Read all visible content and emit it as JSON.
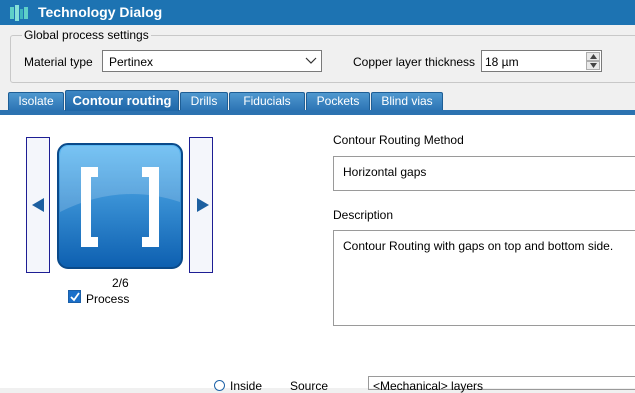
{
  "window": {
    "title": "Technology Dialog",
    "icon": "app-logo-icon"
  },
  "global_settings": {
    "group_label": "Global process settings",
    "material_type_label": "Material type",
    "material_type_value": "Pertinex",
    "copper_thickness_label": "Copper layer thickness",
    "copper_thickness_value": "18 µm"
  },
  "tabs": [
    {
      "label": "Isolate",
      "active": false
    },
    {
      "label": "Contour routing",
      "active": true
    },
    {
      "label": "Drills",
      "active": false
    },
    {
      "label": "Fiducials",
      "active": false
    },
    {
      "label": "Pockets",
      "active": false
    },
    {
      "label": "Blind vias",
      "active": false
    }
  ],
  "contour": {
    "counter": "2/6",
    "process_label": "Process",
    "process_checked": true,
    "method_label": "Contour Routing Method",
    "method_value": "Horizontal gaps",
    "description_label": "Description",
    "description_value": "Contour Routing with gaps on top and bottom side.",
    "inside_label": "Inside",
    "source_label": "Source",
    "source_value": "<Mechanical> layers"
  },
  "colors": {
    "titlebar": "#1d73b2",
    "tab": "#2d75b5",
    "accent": "#1a6fc9",
    "nav_border": "#1e1e94"
  }
}
